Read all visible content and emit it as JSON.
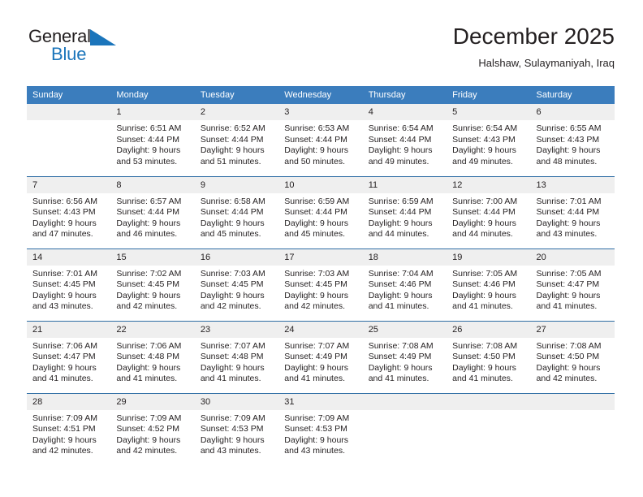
{
  "brand": {
    "name_part1": "General",
    "name_part2": "Blue",
    "accent_color": "#1b75bb"
  },
  "header": {
    "title": "December 2025",
    "subtitle": "Halshaw, Sulaymaniyah, Iraq"
  },
  "calendar": {
    "header_bg": "#3b7dbd",
    "daynum_bg": "#efefef",
    "weekday_headers": [
      "Sunday",
      "Monday",
      "Tuesday",
      "Wednesday",
      "Thursday",
      "Friday",
      "Saturday"
    ],
    "weeks": [
      [
        {
          "day": "",
          "lines": []
        },
        {
          "day": "1",
          "lines": [
            "Sunrise: 6:51 AM",
            "Sunset: 4:44 PM",
            "Daylight: 9 hours",
            "and 53 minutes."
          ]
        },
        {
          "day": "2",
          "lines": [
            "Sunrise: 6:52 AM",
            "Sunset: 4:44 PM",
            "Daylight: 9 hours",
            "and 51 minutes."
          ]
        },
        {
          "day": "3",
          "lines": [
            "Sunrise: 6:53 AM",
            "Sunset: 4:44 PM",
            "Daylight: 9 hours",
            "and 50 minutes."
          ]
        },
        {
          "day": "4",
          "lines": [
            "Sunrise: 6:54 AM",
            "Sunset: 4:44 PM",
            "Daylight: 9 hours",
            "and 49 minutes."
          ]
        },
        {
          "day": "5",
          "lines": [
            "Sunrise: 6:54 AM",
            "Sunset: 4:43 PM",
            "Daylight: 9 hours",
            "and 49 minutes."
          ]
        },
        {
          "day": "6",
          "lines": [
            "Sunrise: 6:55 AM",
            "Sunset: 4:43 PM",
            "Daylight: 9 hours",
            "and 48 minutes."
          ]
        }
      ],
      [
        {
          "day": "7",
          "lines": [
            "Sunrise: 6:56 AM",
            "Sunset: 4:43 PM",
            "Daylight: 9 hours",
            "and 47 minutes."
          ]
        },
        {
          "day": "8",
          "lines": [
            "Sunrise: 6:57 AM",
            "Sunset: 4:44 PM",
            "Daylight: 9 hours",
            "and 46 minutes."
          ]
        },
        {
          "day": "9",
          "lines": [
            "Sunrise: 6:58 AM",
            "Sunset: 4:44 PM",
            "Daylight: 9 hours",
            "and 45 minutes."
          ]
        },
        {
          "day": "10",
          "lines": [
            "Sunrise: 6:59 AM",
            "Sunset: 4:44 PM",
            "Daylight: 9 hours",
            "and 45 minutes."
          ]
        },
        {
          "day": "11",
          "lines": [
            "Sunrise: 6:59 AM",
            "Sunset: 4:44 PM",
            "Daylight: 9 hours",
            "and 44 minutes."
          ]
        },
        {
          "day": "12",
          "lines": [
            "Sunrise: 7:00 AM",
            "Sunset: 4:44 PM",
            "Daylight: 9 hours",
            "and 44 minutes."
          ]
        },
        {
          "day": "13",
          "lines": [
            "Sunrise: 7:01 AM",
            "Sunset: 4:44 PM",
            "Daylight: 9 hours",
            "and 43 minutes."
          ]
        }
      ],
      [
        {
          "day": "14",
          "lines": [
            "Sunrise: 7:01 AM",
            "Sunset: 4:45 PM",
            "Daylight: 9 hours",
            "and 43 minutes."
          ]
        },
        {
          "day": "15",
          "lines": [
            "Sunrise: 7:02 AM",
            "Sunset: 4:45 PM",
            "Daylight: 9 hours",
            "and 42 minutes."
          ]
        },
        {
          "day": "16",
          "lines": [
            "Sunrise: 7:03 AM",
            "Sunset: 4:45 PM",
            "Daylight: 9 hours",
            "and 42 minutes."
          ]
        },
        {
          "day": "17",
          "lines": [
            "Sunrise: 7:03 AM",
            "Sunset: 4:45 PM",
            "Daylight: 9 hours",
            "and 42 minutes."
          ]
        },
        {
          "day": "18",
          "lines": [
            "Sunrise: 7:04 AM",
            "Sunset: 4:46 PM",
            "Daylight: 9 hours",
            "and 41 minutes."
          ]
        },
        {
          "day": "19",
          "lines": [
            "Sunrise: 7:05 AM",
            "Sunset: 4:46 PM",
            "Daylight: 9 hours",
            "and 41 minutes."
          ]
        },
        {
          "day": "20",
          "lines": [
            "Sunrise: 7:05 AM",
            "Sunset: 4:47 PM",
            "Daylight: 9 hours",
            "and 41 minutes."
          ]
        }
      ],
      [
        {
          "day": "21",
          "lines": [
            "Sunrise: 7:06 AM",
            "Sunset: 4:47 PM",
            "Daylight: 9 hours",
            "and 41 minutes."
          ]
        },
        {
          "day": "22",
          "lines": [
            "Sunrise: 7:06 AM",
            "Sunset: 4:48 PM",
            "Daylight: 9 hours",
            "and 41 minutes."
          ]
        },
        {
          "day": "23",
          "lines": [
            "Sunrise: 7:07 AM",
            "Sunset: 4:48 PM",
            "Daylight: 9 hours",
            "and 41 minutes."
          ]
        },
        {
          "day": "24",
          "lines": [
            "Sunrise: 7:07 AM",
            "Sunset: 4:49 PM",
            "Daylight: 9 hours",
            "and 41 minutes."
          ]
        },
        {
          "day": "25",
          "lines": [
            "Sunrise: 7:08 AM",
            "Sunset: 4:49 PM",
            "Daylight: 9 hours",
            "and 41 minutes."
          ]
        },
        {
          "day": "26",
          "lines": [
            "Sunrise: 7:08 AM",
            "Sunset: 4:50 PM",
            "Daylight: 9 hours",
            "and 41 minutes."
          ]
        },
        {
          "day": "27",
          "lines": [
            "Sunrise: 7:08 AM",
            "Sunset: 4:50 PM",
            "Daylight: 9 hours",
            "and 42 minutes."
          ]
        }
      ],
      [
        {
          "day": "28",
          "lines": [
            "Sunrise: 7:09 AM",
            "Sunset: 4:51 PM",
            "Daylight: 9 hours",
            "and 42 minutes."
          ]
        },
        {
          "day": "29",
          "lines": [
            "Sunrise: 7:09 AM",
            "Sunset: 4:52 PM",
            "Daylight: 9 hours",
            "and 42 minutes."
          ]
        },
        {
          "day": "30",
          "lines": [
            "Sunrise: 7:09 AM",
            "Sunset: 4:53 PM",
            "Daylight: 9 hours",
            "and 43 minutes."
          ]
        },
        {
          "day": "31",
          "lines": [
            "Sunrise: 7:09 AM",
            "Sunset: 4:53 PM",
            "Daylight: 9 hours",
            "and 43 minutes."
          ]
        },
        {
          "day": "",
          "lines": []
        },
        {
          "day": "",
          "lines": []
        },
        {
          "day": "",
          "lines": []
        }
      ]
    ]
  }
}
